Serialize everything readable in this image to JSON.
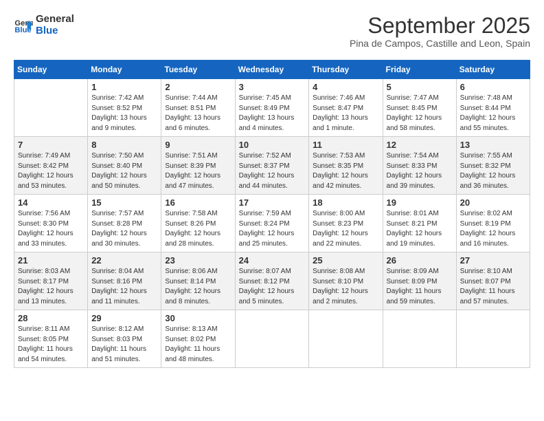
{
  "header": {
    "logo_line1": "General",
    "logo_line2": "Blue",
    "month_title": "September 2025",
    "location": "Pina de Campos, Castille and Leon, Spain"
  },
  "columns": [
    "Sunday",
    "Monday",
    "Tuesday",
    "Wednesday",
    "Thursday",
    "Friday",
    "Saturday"
  ],
  "weeks": [
    [
      {
        "num": "",
        "info": ""
      },
      {
        "num": "1",
        "info": "Sunrise: 7:42 AM\nSunset: 8:52 PM\nDaylight: 13 hours\nand 9 minutes."
      },
      {
        "num": "2",
        "info": "Sunrise: 7:44 AM\nSunset: 8:51 PM\nDaylight: 13 hours\nand 6 minutes."
      },
      {
        "num": "3",
        "info": "Sunrise: 7:45 AM\nSunset: 8:49 PM\nDaylight: 13 hours\nand 4 minutes."
      },
      {
        "num": "4",
        "info": "Sunrise: 7:46 AM\nSunset: 8:47 PM\nDaylight: 13 hours\nand 1 minute."
      },
      {
        "num": "5",
        "info": "Sunrise: 7:47 AM\nSunset: 8:45 PM\nDaylight: 12 hours\nand 58 minutes."
      },
      {
        "num": "6",
        "info": "Sunrise: 7:48 AM\nSunset: 8:44 PM\nDaylight: 12 hours\nand 55 minutes."
      }
    ],
    [
      {
        "num": "7",
        "info": "Sunrise: 7:49 AM\nSunset: 8:42 PM\nDaylight: 12 hours\nand 53 minutes."
      },
      {
        "num": "8",
        "info": "Sunrise: 7:50 AM\nSunset: 8:40 PM\nDaylight: 12 hours\nand 50 minutes."
      },
      {
        "num": "9",
        "info": "Sunrise: 7:51 AM\nSunset: 8:39 PM\nDaylight: 12 hours\nand 47 minutes."
      },
      {
        "num": "10",
        "info": "Sunrise: 7:52 AM\nSunset: 8:37 PM\nDaylight: 12 hours\nand 44 minutes."
      },
      {
        "num": "11",
        "info": "Sunrise: 7:53 AM\nSunset: 8:35 PM\nDaylight: 12 hours\nand 42 minutes."
      },
      {
        "num": "12",
        "info": "Sunrise: 7:54 AM\nSunset: 8:33 PM\nDaylight: 12 hours\nand 39 minutes."
      },
      {
        "num": "13",
        "info": "Sunrise: 7:55 AM\nSunset: 8:32 PM\nDaylight: 12 hours\nand 36 minutes."
      }
    ],
    [
      {
        "num": "14",
        "info": "Sunrise: 7:56 AM\nSunset: 8:30 PM\nDaylight: 12 hours\nand 33 minutes."
      },
      {
        "num": "15",
        "info": "Sunrise: 7:57 AM\nSunset: 8:28 PM\nDaylight: 12 hours\nand 30 minutes."
      },
      {
        "num": "16",
        "info": "Sunrise: 7:58 AM\nSunset: 8:26 PM\nDaylight: 12 hours\nand 28 minutes."
      },
      {
        "num": "17",
        "info": "Sunrise: 7:59 AM\nSunset: 8:24 PM\nDaylight: 12 hours\nand 25 minutes."
      },
      {
        "num": "18",
        "info": "Sunrise: 8:00 AM\nSunset: 8:23 PM\nDaylight: 12 hours\nand 22 minutes."
      },
      {
        "num": "19",
        "info": "Sunrise: 8:01 AM\nSunset: 8:21 PM\nDaylight: 12 hours\nand 19 minutes."
      },
      {
        "num": "20",
        "info": "Sunrise: 8:02 AM\nSunset: 8:19 PM\nDaylight: 12 hours\nand 16 minutes."
      }
    ],
    [
      {
        "num": "21",
        "info": "Sunrise: 8:03 AM\nSunset: 8:17 PM\nDaylight: 12 hours\nand 13 minutes."
      },
      {
        "num": "22",
        "info": "Sunrise: 8:04 AM\nSunset: 8:16 PM\nDaylight: 12 hours\nand 11 minutes."
      },
      {
        "num": "23",
        "info": "Sunrise: 8:06 AM\nSunset: 8:14 PM\nDaylight: 12 hours\nand 8 minutes."
      },
      {
        "num": "24",
        "info": "Sunrise: 8:07 AM\nSunset: 8:12 PM\nDaylight: 12 hours\nand 5 minutes."
      },
      {
        "num": "25",
        "info": "Sunrise: 8:08 AM\nSunset: 8:10 PM\nDaylight: 12 hours\nand 2 minutes."
      },
      {
        "num": "26",
        "info": "Sunrise: 8:09 AM\nSunset: 8:09 PM\nDaylight: 11 hours\nand 59 minutes."
      },
      {
        "num": "27",
        "info": "Sunrise: 8:10 AM\nSunset: 8:07 PM\nDaylight: 11 hours\nand 57 minutes."
      }
    ],
    [
      {
        "num": "28",
        "info": "Sunrise: 8:11 AM\nSunset: 8:05 PM\nDaylight: 11 hours\nand 54 minutes."
      },
      {
        "num": "29",
        "info": "Sunrise: 8:12 AM\nSunset: 8:03 PM\nDaylight: 11 hours\nand 51 minutes."
      },
      {
        "num": "30",
        "info": "Sunrise: 8:13 AM\nSunset: 8:02 PM\nDaylight: 11 hours\nand 48 minutes."
      },
      {
        "num": "",
        "info": ""
      },
      {
        "num": "",
        "info": ""
      },
      {
        "num": "",
        "info": ""
      },
      {
        "num": "",
        "info": ""
      }
    ]
  ]
}
